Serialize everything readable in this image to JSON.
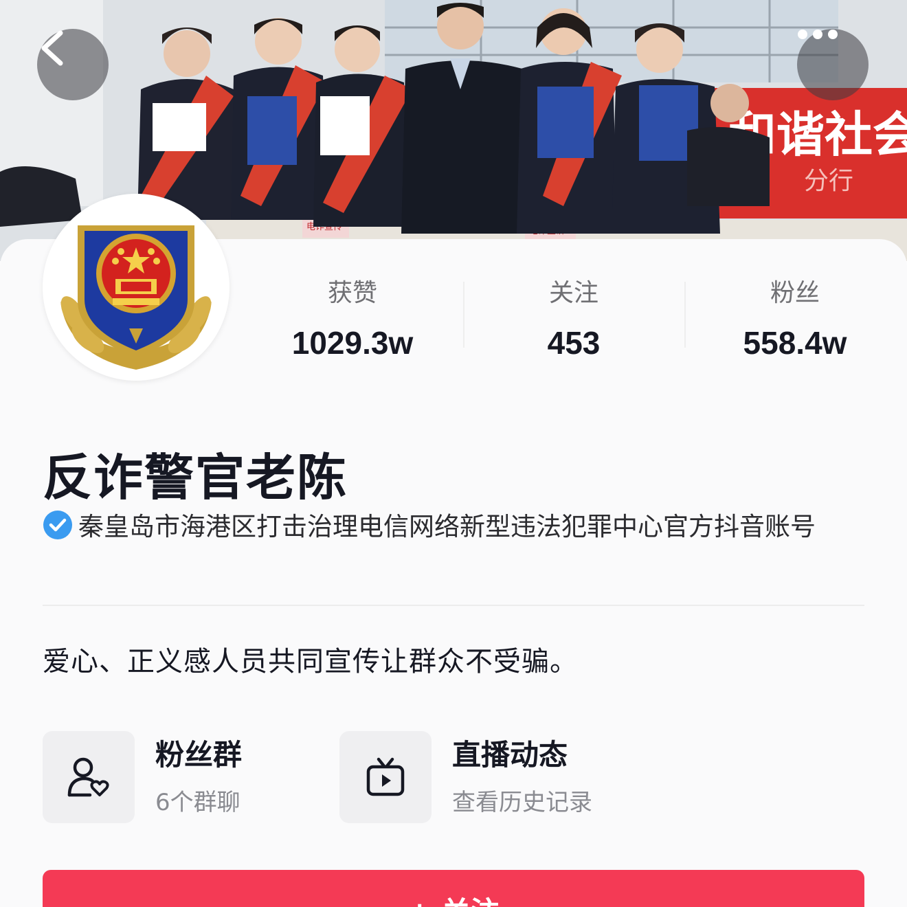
{
  "cover": {
    "banner_text": "和谐社会",
    "banner_sub": "分行",
    "table_sign_1": "电诈宣传",
    "table_sign_2": "电诈宣讲"
  },
  "nav": {
    "back_icon": "chevron-left-icon",
    "more_icon": "more-dots-icon"
  },
  "stats": [
    {
      "label": "获赞",
      "value": "1029.3w"
    },
    {
      "label": "关注",
      "value": "453"
    },
    {
      "label": "粉丝",
      "value": "558.4w"
    }
  ],
  "profile": {
    "name": "反诈警官老陈",
    "verification": "秦皇岛市海港区打击治理电信网络新型违法犯罪中心官方抖音账号",
    "verify_icon": "verified-check-icon",
    "bio": "爱心、正义感人员共同宣传让群众不受骗。"
  },
  "features": {
    "fans_group": {
      "title": "粉丝群",
      "subtitle": "6个群聊",
      "icon": "user-heart-icon"
    },
    "live": {
      "title": "直播动态",
      "subtitle": "查看历史记录",
      "icon": "tv-play-icon"
    }
  },
  "follow_button": {
    "label": "+ 关注"
  },
  "colors": {
    "accent": "#f43a55",
    "verify_blue": "#3a9bf0",
    "text_primary": "#161823",
    "text_secondary": "#8a8b91"
  }
}
